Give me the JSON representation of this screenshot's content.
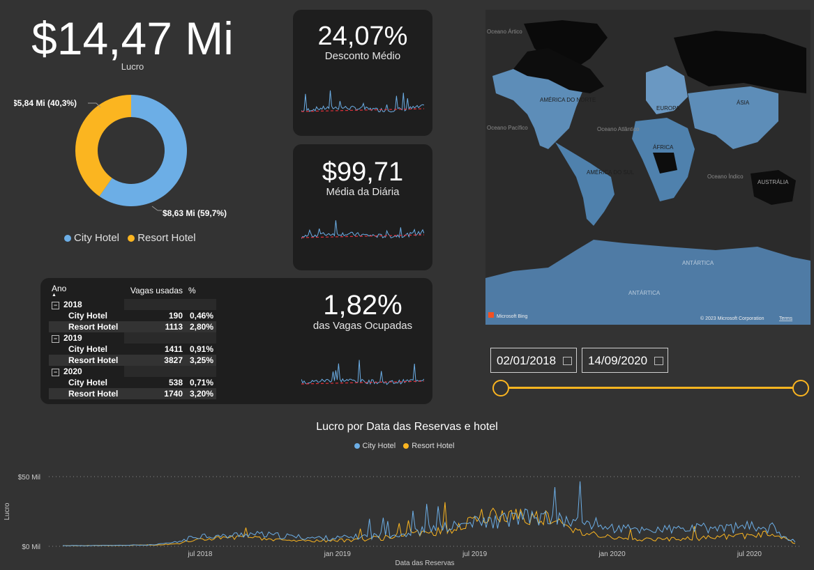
{
  "kpi_lucro": {
    "value": "$14,47 Mi",
    "label": "Lucro"
  },
  "donut": {
    "slices": [
      {
        "name": "City Hotel",
        "value": 8.63,
        "label": "$8,63 Mi (59,7%)",
        "color": "#6CAEE6"
      },
      {
        "name": "Resort Hotel",
        "value": 5.84,
        "label": "$5,84 Mi (40,3%)",
        "color": "#FBB520"
      }
    ],
    "legend": [
      "City Hotel",
      "Resort Hotel"
    ]
  },
  "cards": {
    "desconto": {
      "value": "24,07%",
      "label": "Desconto Médio"
    },
    "diaria": {
      "value": "$99,71",
      "label": "Média da Diária"
    },
    "vagas": {
      "value": "1,82%",
      "label": "das Vagas Ocupadas"
    }
  },
  "table": {
    "headers": {
      "ano": "Ano",
      "vagas": "Vagas usadas",
      "pct": "%"
    },
    "groups": [
      {
        "year": "2018",
        "rows": [
          {
            "name": "City Hotel",
            "vagas": "190",
            "pct": "0,46%"
          },
          {
            "name": "Resort Hotel",
            "vagas": "1113",
            "pct": "2,80%"
          }
        ]
      },
      {
        "year": "2019",
        "rows": [
          {
            "name": "City Hotel",
            "vagas": "1411",
            "pct": "0,91%"
          },
          {
            "name": "Resort Hotel",
            "vagas": "3827",
            "pct": "3,25%"
          }
        ]
      },
      {
        "year": "2020",
        "rows": [
          {
            "name": "City Hotel",
            "vagas": "538",
            "pct": "0,71%"
          },
          {
            "name": "Resort Hotel",
            "vagas": "1740",
            "pct": "3,20%"
          }
        ]
      }
    ]
  },
  "map": {
    "labels": {
      "oceano_artico": "Oceano Ártico",
      "america_norte": "AMÉRICA DO NORTE",
      "europa": "EUROPA",
      "asia": "ÁSIA",
      "oceano_pacifico": "Oceano Pacífico",
      "oceano_atlantico": "Oceano Atlântico",
      "africa": "ÁFRICA",
      "america_sul": "AMÉRICA DO SUL",
      "oceano_indico": "Oceano Índico",
      "australia": "AUSTRÁLIA",
      "antartica": "ANTÁRTICA"
    },
    "attribution": "© 2023 Microsoft Corporation",
    "terms": "Terms",
    "bing": "Microsoft Bing"
  },
  "slicer": {
    "start": "02/01/2018",
    "end": "14/09/2020",
    "accent": "#FBB520"
  },
  "chart_data": {
    "type": "line",
    "title": "Lucro por Data das Reservas e hotel",
    "xlabel": "Data das Reservas",
    "ylabel": "Lucro",
    "ylim": [
      0,
      60
    ],
    "yticks": [
      "$0 Mil",
      "$50 Mil"
    ],
    "xticks": [
      "jul 2018",
      "jan 2019",
      "jul 2019",
      "jan 2020",
      "jul 2020"
    ],
    "legend": [
      "City Hotel",
      "Resort Hotel"
    ],
    "x": [
      "2018-01",
      "2018-02",
      "2018-03",
      "2018-04",
      "2018-05",
      "2018-06",
      "2018-07",
      "2018-08",
      "2018-09",
      "2018-10",
      "2018-11",
      "2018-12",
      "2019-01",
      "2019-02",
      "2019-03",
      "2019-04",
      "2019-05",
      "2019-06",
      "2019-07",
      "2019-08",
      "2019-09",
      "2019-10",
      "2019-11",
      "2019-12",
      "2020-01",
      "2020-02",
      "2020-03",
      "2020-04",
      "2020-05",
      "2020-06",
      "2020-07",
      "2020-08",
      "2020-09"
    ],
    "series": [
      {
        "name": "City Hotel",
        "color": "#6CAEE6",
        "values": [
          0.5,
          0.5,
          0.6,
          0.8,
          1,
          3,
          8,
          7,
          9,
          8,
          7,
          6,
          6,
          7,
          8,
          9,
          12,
          14,
          17,
          18,
          21,
          20,
          18,
          17,
          13,
          12,
          12,
          12,
          13,
          13,
          14,
          13,
          3
        ]
      },
      {
        "name": "Resort Hotel",
        "color": "#FBB520",
        "values": [
          0.5,
          0.5,
          0.6,
          0.8,
          1,
          2,
          5,
          6,
          6,
          5,
          4,
          4,
          4,
          5,
          6,
          8,
          10,
          12,
          20,
          22,
          23,
          21,
          14,
          10,
          6,
          5,
          5,
          5,
          6,
          7,
          8,
          9,
          2
        ]
      }
    ]
  }
}
